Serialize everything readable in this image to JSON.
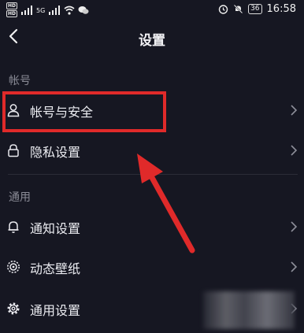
{
  "status_bar": {
    "hd1": "HD",
    "hd2": "HD",
    "signal_label": "5G",
    "battery": "36",
    "time": "16:58"
  },
  "nav": {
    "title": "设置"
  },
  "sections": {
    "account_header": "帐号",
    "general_header": "通用"
  },
  "rows": {
    "account_security": "帐号与安全",
    "privacy": "隐私设置",
    "notifications": "通知设置",
    "live_wallpaper": "动态壁纸",
    "general_settings": "通用设置"
  },
  "colors": {
    "background": "#161722",
    "annotation_red": "#e02a2a"
  }
}
